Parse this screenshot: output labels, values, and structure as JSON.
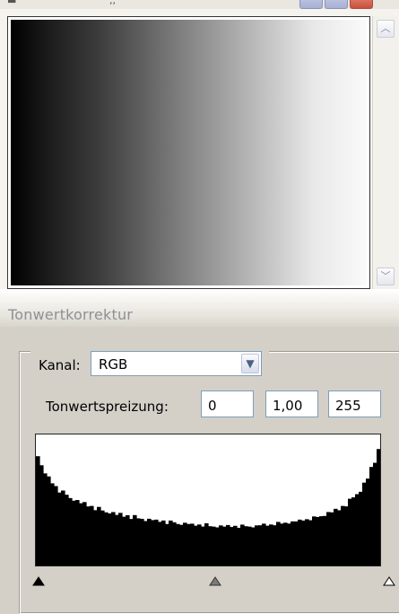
{
  "palette": {
    "title": "Tonwertkorrektur",
    "channel_label": "Kanal:",
    "channel_value": "RGB",
    "output_levels_label": "Tonwertspreizung:",
    "output_levels": [
      "0",
      "1,00",
      "255"
    ]
  },
  "histogram": {
    "values": [
      0.86,
      0.75,
      0.71,
      0.66,
      0.64,
      0.6,
      0.58,
      0.55,
      0.54,
      0.52,
      0.51,
      0.49,
      0.48,
      0.47,
      0.46,
      0.45,
      0.44,
      0.43,
      0.42,
      0.41,
      0.41,
      0.4,
      0.39,
      0.39,
      0.38,
      0.38,
      0.37,
      0.37,
      0.36,
      0.36,
      0.35,
      0.35,
      0.35,
      0.34,
      0.34,
      0.34,
      0.33,
      0.33,
      0.33,
      0.32,
      0.32,
      0.32,
      0.32,
      0.31,
      0.31,
      0.31,
      0.31,
      0.31,
      0.3,
      0.3,
      0.3,
      0.3,
      0.3,
      0.3,
      0.3,
      0.3,
      0.3,
      0.3,
      0.3,
      0.3,
      0.3,
      0.3,
      0.31,
      0.31,
      0.31,
      0.31,
      0.32,
      0.32,
      0.32,
      0.33,
      0.33,
      0.33,
      0.34,
      0.34,
      0.35,
      0.35,
      0.36,
      0.36,
      0.37,
      0.38,
      0.39,
      0.4,
      0.41,
      0.42,
      0.43,
      0.45,
      0.47,
      0.49,
      0.52,
      0.55,
      0.58,
      0.62,
      0.67,
      0.73,
      0.8,
      0.88
    ],
    "input_black": 0,
    "input_gamma": 1.0,
    "input_white": 255
  },
  "colors": {
    "histogram_fill": "#000000",
    "field_border": "#7f9db9",
    "panel_bg": "#d4d0c8"
  },
  "icons": {
    "channel_dropdown": "chevron-down-icon",
    "scroll_up": "scroll-up-icon",
    "scroll_down": "scroll-down-icon"
  }
}
